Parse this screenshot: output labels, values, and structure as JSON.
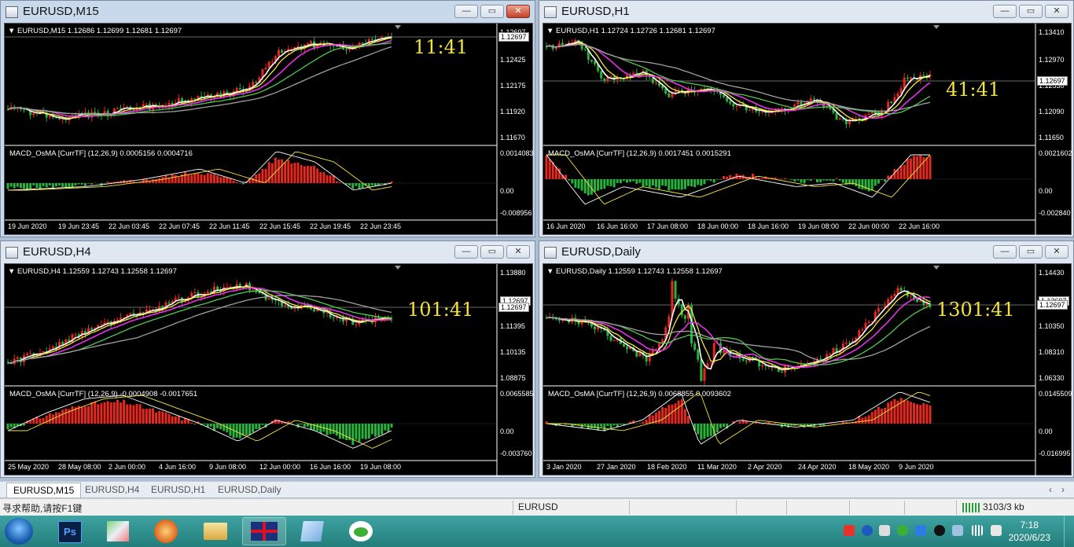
{
  "windows": [
    {
      "title": "EURUSD,M15",
      "info": "EURUSD,M15  1.12686 1.12699 1.12681 1.12697",
      "yTicks": [
        "1.12697",
        "1.12425",
        "1.12175",
        "1.11920",
        "1.11670"
      ],
      "ylabTop": "1.12697",
      "macdInfo": "MACD_OsMA [CurrTF] (12,26,9) 0.0005156 0.0004716",
      "macdTicks": [
        "0.0014083",
        "0.00",
        "-0.008956"
      ],
      "xTicks": [
        "19 Jun 2020",
        "19 Jun 23:45",
        "22 Jun 03:45",
        "22 Jun 07:45",
        "22 Jun 11:45",
        "22 Jun 15:45",
        "22 Jun 19:45",
        "22 Jun 23:45"
      ],
      "timer": "11:41"
    },
    {
      "title": "EURUSD,H1",
      "info": "EURUSD,H1  1.12724 1.12726 1.12681 1.12697",
      "yTicks": [
        "1.13410",
        "1.12970",
        "1.12530",
        "1.12090",
        "1.11650"
      ],
      "ylabTop": "1.12697",
      "macdInfo": "MACD_OsMA [CurrTF] (12,26,9) 0.0017451 0.0015291",
      "macdTicks": [
        "0.0021602",
        "0.00",
        "-0.002840"
      ],
      "xTicks": [
        "16 Jun 2020",
        "16 Jun 16:00",
        "17 Jun 08:00",
        "18 Jun 00:00",
        "18 Jun 16:00",
        "19 Jun 08:00",
        "22 Jun 00:00",
        "22 Jun 16:00"
      ],
      "timer": "41:41"
    },
    {
      "title": "EURUSD,H4",
      "info": "EURUSD,H4  1.12559 1.12743 1.12558 1.12697",
      "yTicks": [
        "1.13880",
        "1.12697",
        "1.11395",
        "1.10135",
        "1.08875"
      ],
      "ylabTop": "1.12697",
      "macdInfo": "MACD_OsMA [CurrTF] (12,26,9) -0.0004908 -0.0017651",
      "macdTicks": [
        "0.0065585",
        "0.00",
        "-0.003760"
      ],
      "xTicks": [
        "25 May 2020",
        "28 May 08:00",
        "2 Jun 00:00",
        "4 Jun 16:00",
        "9 Jun 08:00",
        "12 Jun 00:00",
        "16 Jun 16:00",
        "19 Jun 08:00"
      ],
      "timer": "101:41"
    },
    {
      "title": "EURUSD,Daily",
      "info": "EURUSD,Daily  1.12559 1.12743 1.12558 1.12697",
      "yTicks": [
        "1.14430",
        "1.12697",
        "1.10350",
        "1.08310",
        "1.06330"
      ],
      "ylabTop": "1.12697",
      "macdInfo": "MACD_OsMA [CurrTF] (12,26,9) 0.0068855 0.0093602",
      "macdTicks": [
        "0.0145509",
        "0.00",
        "-0.016995"
      ],
      "xTicks": [
        "3 Jan 2020",
        "27 Jan 2020",
        "18 Feb 2020",
        "11 Mar 2020",
        "2 Apr 2020",
        "24 Apr 2020",
        "18 May 2020",
        "9 Jun 2020"
      ],
      "timer": "1301:41"
    }
  ],
  "tabs": [
    "EURUSD,M15",
    "EURUSD,H4",
    "EURUSD,H1",
    "EURUSD,Daily"
  ],
  "status": {
    "help": "寻求帮助,请按F1键",
    "symbol": "EURUSD",
    "traffic": "3103/3 kb"
  },
  "clock": {
    "time": "7:18",
    "date": "2020/6/23"
  },
  "colors": {
    "bull": "#e8281e",
    "bear": "#28b43c",
    "timer": "#f2e33d",
    "ma_white": "#ffffff",
    "ma_yellow": "#f5e63c",
    "ma_magenta": "#e632e6",
    "ma_green": "#50c850",
    "ma_gray": "#a0a0a0"
  }
}
